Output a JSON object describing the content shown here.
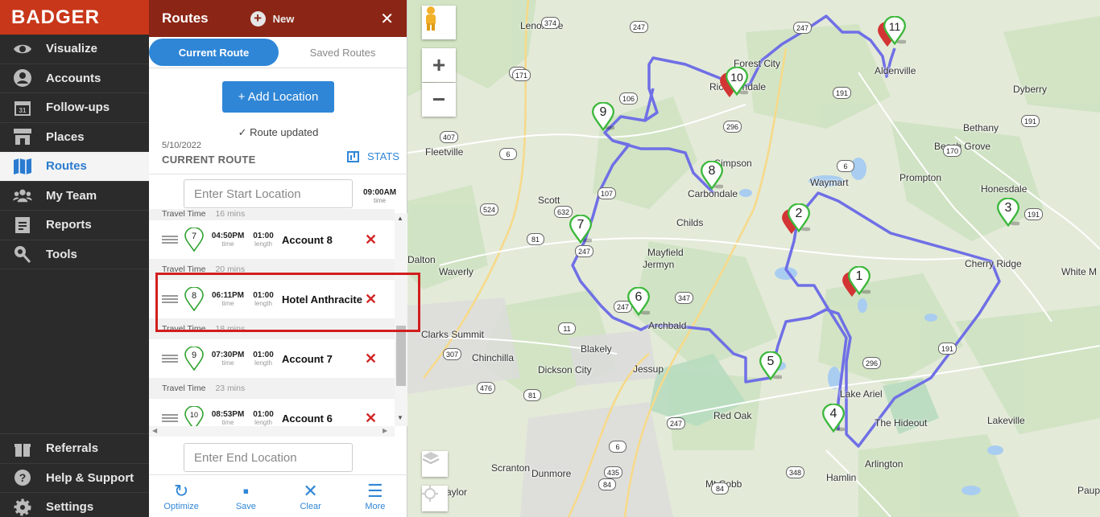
{
  "brand": {
    "logo": "BADGER"
  },
  "nav": {
    "items": [
      {
        "label": "Visualize",
        "icon": "eye-icon"
      },
      {
        "label": "Accounts",
        "icon": "person-icon"
      },
      {
        "label": "Follow-ups",
        "icon": "calendar-icon"
      },
      {
        "label": "Places",
        "icon": "store-icon"
      },
      {
        "label": "Routes",
        "icon": "map-icon",
        "active": true
      },
      {
        "label": "My Team",
        "icon": "team-icon"
      },
      {
        "label": "Reports",
        "icon": "report-icon"
      },
      {
        "label": "Tools",
        "icon": "tools-icon"
      }
    ],
    "bottom": [
      {
        "label": "Referrals",
        "icon": "gift-icon"
      },
      {
        "label": "Help & Support",
        "icon": "help-icon"
      },
      {
        "label": "Settings",
        "icon": "gear-icon"
      }
    ]
  },
  "panel": {
    "title": "Routes",
    "new_label": "New",
    "close": "✕",
    "tabs": {
      "current": "Current Route",
      "saved": "Saved Routes"
    },
    "add_location": "+ Add Location",
    "status": "✓  Route updated",
    "date": "5/10/2022",
    "route_label": "CURRENT ROUTE",
    "stats_label": "STATS",
    "start_placeholder": "Enter Start Location",
    "start_time": "09:00AM",
    "start_time_sub": "time",
    "end_placeholder": "Enter End Location",
    "time_sub": "time",
    "length_sub": "length",
    "travel_label": "Travel Time",
    "stops": [
      {
        "num": "7",
        "time": "04:50PM",
        "length": "01:00",
        "name": "Account 8",
        "travel": "20 mins"
      },
      {
        "num": "8",
        "time": "06:11PM",
        "length": "01:00",
        "name": "Hotel Anthracite",
        "travel": "18 mins"
      },
      {
        "num": "9",
        "time": "07:30PM",
        "length": "01:00",
        "name": "Account 7",
        "travel": "23 mins"
      },
      {
        "num": "10",
        "time": "08:53PM",
        "length": "01:00",
        "name": "Account 6",
        "travel": ""
      }
    ],
    "top_partial": {
      "label": "Travel Time",
      "value": "16 mins"
    },
    "toolbar": [
      {
        "label": "Optimize",
        "icon": "optimize-icon"
      },
      {
        "label": "Save",
        "icon": "save-icon"
      },
      {
        "label": "Clear",
        "icon": "clear-icon"
      },
      {
        "label": "More",
        "icon": "menu-icon"
      }
    ]
  },
  "map": {
    "places": [
      "Lenoxville",
      "Forest City",
      "Richmondale",
      "Aldenville",
      "Dyberry",
      "Bethany",
      "Beech Grove",
      "Fleetville",
      "Simpson",
      "Carbondale",
      "Waymart",
      "Prompton",
      "Honesdale",
      "Scott",
      "Childs",
      "Dalton",
      "Waverly",
      "Mayfield",
      "Jermyn",
      "Cherry Ridge",
      "White M",
      "Archbald",
      "Clarks Summit",
      "Chinchilla",
      "Blakely",
      "Dickson City",
      "Jessup",
      "Lake Ariel",
      "The Hideout",
      "Lakeville",
      "Red Oak",
      "Dunmore",
      "Scranton",
      "Mt Cobb",
      "Arlington",
      "Hamlin",
      "Taylor",
      "Paup"
    ],
    "roads": [
      "374",
      "247",
      "81",
      "106",
      "247",
      "171",
      "296",
      "191",
      "407",
      "6",
      "170",
      "191",
      "107",
      "524",
      "632",
      "81",
      "6",
      "247",
      "247",
      "347",
      "11",
      "307",
      "476",
      "81",
      "296",
      "191",
      "247",
      "6",
      "435",
      "348",
      "84",
      "84",
      "191"
    ],
    "markers": [
      "1",
      "2",
      "3",
      "4",
      "5",
      "6",
      "7",
      "8",
      "9",
      "10",
      "11"
    ],
    "zoom_in": "+",
    "zoom_out": "−",
    "colors": {
      "route": "#6f6fe6",
      "pin_green": "#3cb83c",
      "pin_red": "#d33434"
    }
  }
}
